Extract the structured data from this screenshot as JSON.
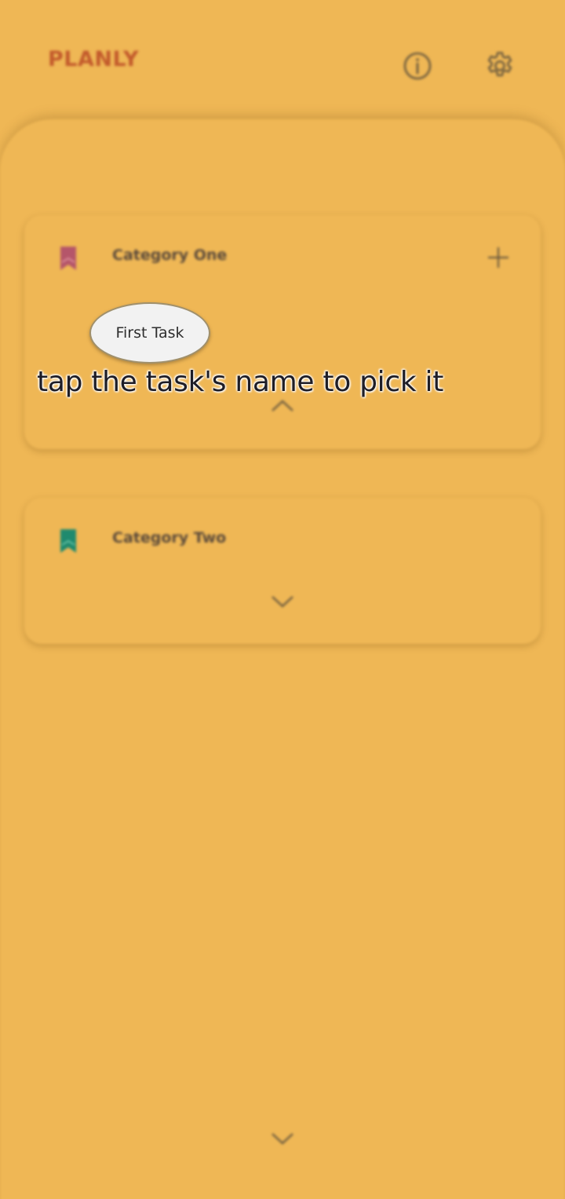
{
  "app": {
    "logo": "PLANLY"
  },
  "header": {
    "info_icon": "info-icon",
    "settings_icon": "gear-icon"
  },
  "categories": [
    {
      "title": "Category One",
      "color": "#b5566a",
      "icon": "bookmark-icon",
      "add_icon": "plus-icon",
      "expand_icon": "chevron-up-icon"
    },
    {
      "title": "Category Two",
      "color": "#1f8a6e",
      "icon": "bookmark-icon",
      "expand_icon": "chevron-down-icon"
    }
  ],
  "tutorial": {
    "task_name": "First Task",
    "hint": "tap the task's name to pick it"
  },
  "colors": {
    "background": "#efb755",
    "logo": "#c25a2c",
    "icon_stroke": "#6b5a3e"
  }
}
